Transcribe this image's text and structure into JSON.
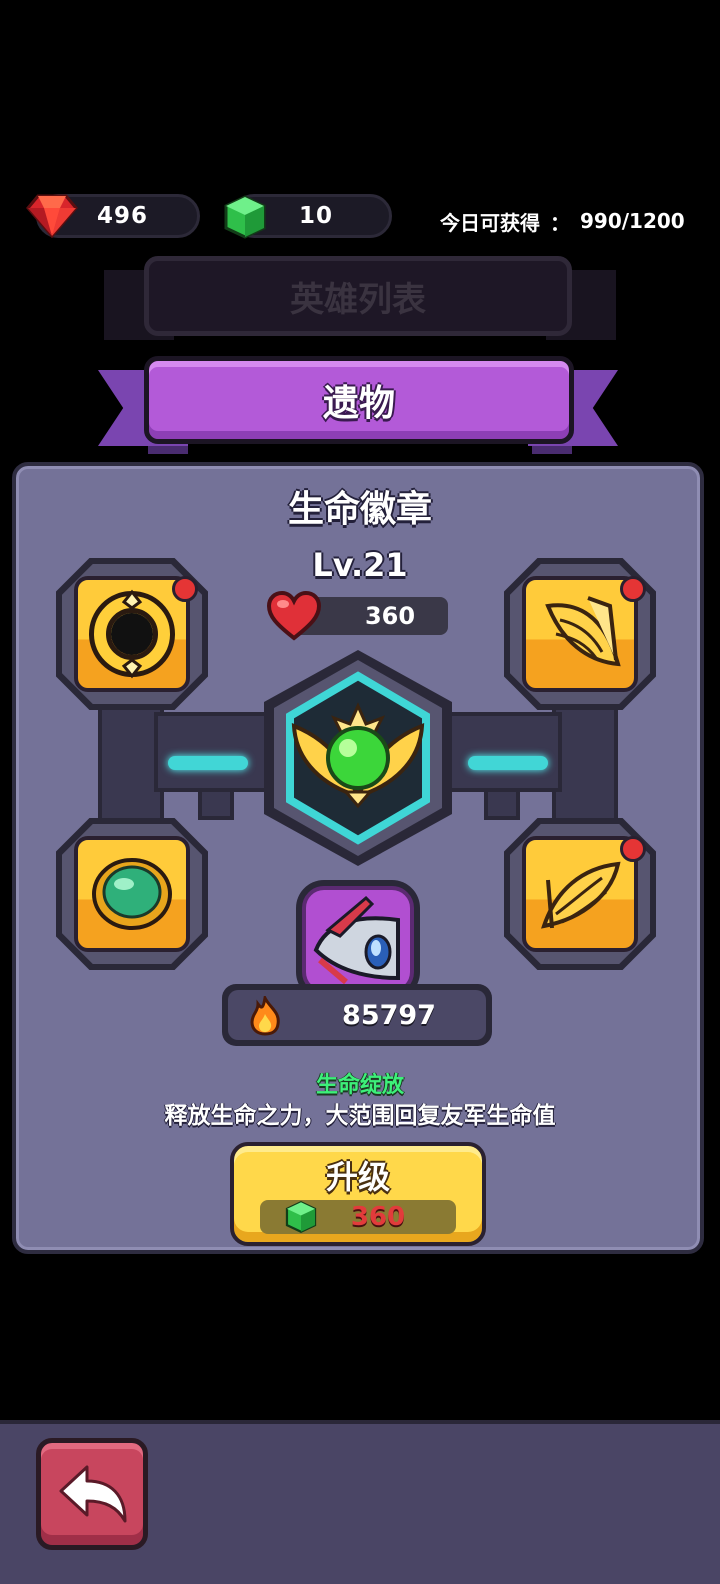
{
  "currency": {
    "ruby": "496",
    "gem": "10",
    "daily_label": "今日可获得",
    "daily_sep": "：",
    "daily_value": "990/1200"
  },
  "tabs": {
    "inactive_label": "英雄列表",
    "active_label": "遗物"
  },
  "relic": {
    "name": "生命徽章",
    "level": "Lv.21",
    "hp": "360",
    "power": "85797",
    "skill_name": "生命绽放",
    "skill_desc": "释放生命之力，大范围回复友军生命值"
  },
  "upgrade": {
    "label": "升级",
    "cost": "360"
  },
  "slots": [
    {
      "icon": "ring-icon",
      "alert": true
    },
    {
      "icon": "wing-icon",
      "alert": true
    },
    {
      "icon": "emerald-icon",
      "alert": false
    },
    {
      "icon": "wing-icon",
      "alert": true
    }
  ],
  "colors": {
    "panel": "#747298",
    "tab_active": "#b35ad8",
    "upgrade": "#ffd84a",
    "cost_text": "#e23b3b",
    "skill_name": "#3df07a"
  }
}
